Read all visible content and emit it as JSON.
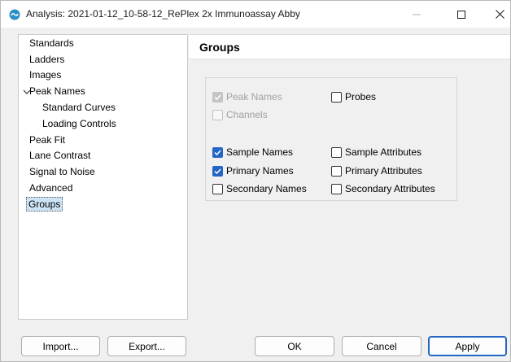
{
  "window": {
    "title": "Analysis: 2021-01-12_10-58-12_RePlex 2x Immunoassay Abby",
    "minimize_icon": "minimize-icon",
    "maximize_icon": "maximize-icon",
    "close_icon": "close-icon"
  },
  "nav": {
    "items": [
      {
        "label": "Standards"
      },
      {
        "label": "Ladders"
      },
      {
        "label": "Images"
      },
      {
        "label": "Peak Names",
        "expanded": true
      },
      {
        "label": "Standard Curves"
      },
      {
        "label": "Loading Controls"
      },
      {
        "label": "Peak Fit"
      },
      {
        "label": "Lane Contrast"
      },
      {
        "label": "Signal to Noise"
      },
      {
        "label": "Advanced"
      },
      {
        "label": "Groups",
        "selected": true
      }
    ]
  },
  "panel": {
    "title": "Groups",
    "checkboxes": {
      "peak_names": {
        "label": "Peak Names",
        "checked": true,
        "enabled": false
      },
      "probes": {
        "label": "Probes",
        "checked": false,
        "enabled": true
      },
      "channels": {
        "label": "Channels",
        "checked": false,
        "enabled": false
      },
      "sample_names": {
        "label": "Sample Names",
        "checked": true,
        "enabled": true
      },
      "sample_attributes": {
        "label": "Sample Attributes",
        "checked": false,
        "enabled": true
      },
      "primary_names": {
        "label": "Primary Names",
        "checked": true,
        "enabled": true
      },
      "primary_attributes": {
        "label": "Primary Attributes",
        "checked": false,
        "enabled": true
      },
      "secondary_names": {
        "label": "Secondary Names",
        "checked": false,
        "enabled": true
      },
      "secondary_attributes": {
        "label": "Secondary Attributes",
        "checked": false,
        "enabled": true
      }
    }
  },
  "buttons": {
    "import": "Import...",
    "export": "Export...",
    "ok": "OK",
    "cancel": "Cancel",
    "apply": "Apply"
  },
  "colors": {
    "accent": "#2466c4",
    "selection": "#cde4f7"
  }
}
